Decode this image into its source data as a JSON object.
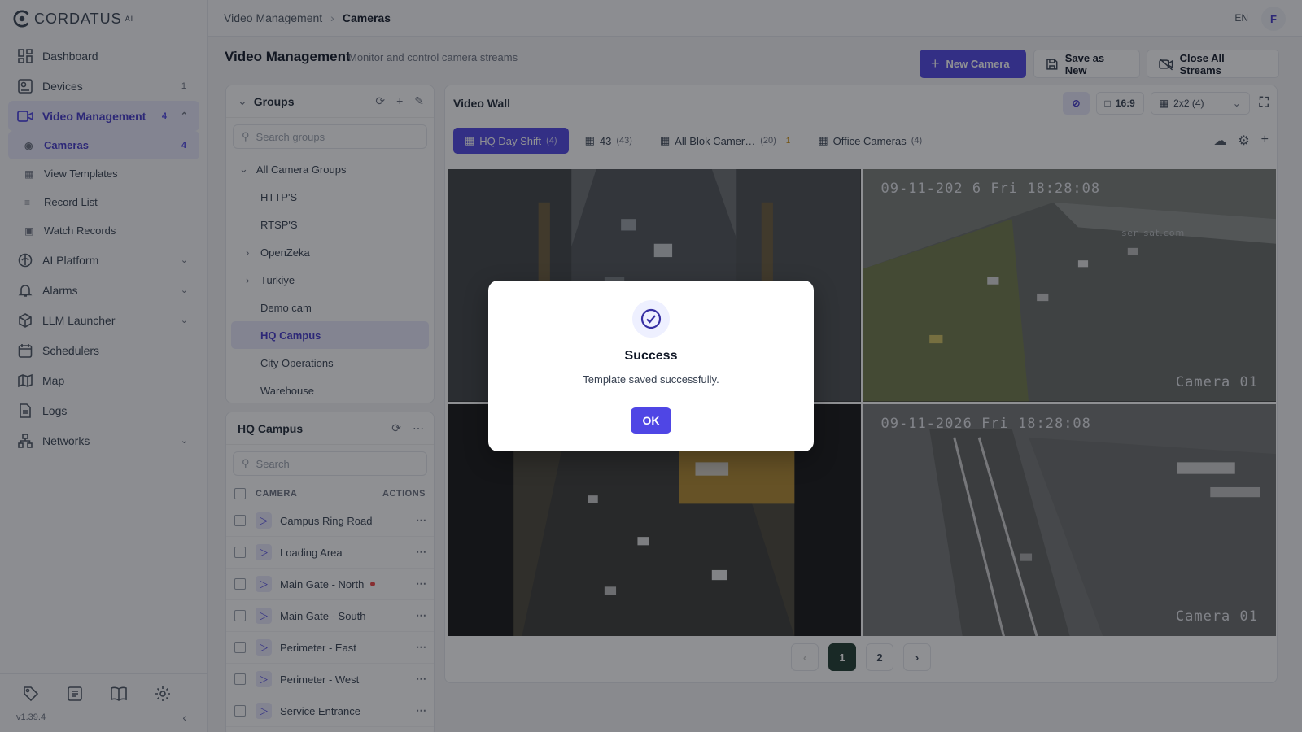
{
  "app": {
    "brand": "CORDATUS",
    "brand_sup": "AI",
    "version": "v1.39.4"
  },
  "sidebar": {
    "items": [
      {
        "label": "Dashboard",
        "icon": "dashboard-icon"
      },
      {
        "label": "Devices",
        "icon": "devices-icon",
        "badge": "1"
      },
      {
        "label": "Video Management",
        "icon": "video-icon",
        "badge": "4",
        "active": true
      },
      {
        "label": "AI Platform",
        "icon": "ai-icon"
      },
      {
        "label": "Alarms",
        "icon": "bell-icon"
      },
      {
        "label": "LLM Launcher",
        "icon": "llm-icon"
      },
      {
        "label": "Schedulers",
        "icon": "calendar-icon"
      },
      {
        "label": "Map",
        "icon": "map-icon"
      },
      {
        "label": "Logs",
        "icon": "logs-icon"
      },
      {
        "label": "Networks",
        "icon": "network-icon"
      }
    ],
    "subitems": [
      {
        "label": "Cameras",
        "badge": "4",
        "active": true
      },
      {
        "label": "View Templates"
      },
      {
        "label": "Record List"
      },
      {
        "label": "Watch Records"
      }
    ]
  },
  "topbar": {
    "crumb1": "Video Management",
    "crumb2": "Cameras",
    "lang": "EN",
    "avatar": "F"
  },
  "header": {
    "title": "Video Management",
    "subtitle": "Monitor and control camera streams",
    "new_camera": "New Camera",
    "save_as_new": "Save as New",
    "close_all": "Close All Streams"
  },
  "groups": {
    "title": "Groups",
    "search_placeholder": "Search groups",
    "root": "All Camera Groups",
    "items": [
      "HTTP'S",
      "RTSP'S",
      "OpenZeka",
      "Turkiye",
      "Demo cam",
      "HQ Campus",
      "City Operations",
      "Warehouse"
    ]
  },
  "camera_list": {
    "title": "HQ Campus",
    "search_placeholder": "Search",
    "col_camera": "CAMERA",
    "col_actions": "ACTIONS",
    "rows": [
      "Campus Ring Road",
      "Loading Area",
      "Main Gate - North",
      "Main Gate - South",
      "Perimeter - East",
      "Perimeter - West",
      "Service Entrance"
    ]
  },
  "wall": {
    "title": "Video Wall",
    "ratio": "16:9",
    "layout": "2x2 (4)",
    "tabs": [
      {
        "label": "HQ Day Shift",
        "count": "(4)"
      },
      {
        "label": "43",
        "count": "(43)"
      },
      {
        "label": "All Blok Camer…",
        "count": "(20)",
        "warn": "1"
      },
      {
        "label": "Office Cameras",
        "count": "(4)"
      }
    ],
    "osd": {
      "cam2_time": "09-11-202  6 Fri 18:28:08",
      "cam2_name": "Camera 01",
      "cam2_watermark": "sen sat.com",
      "cam4_time": "09-11-2026 Fri 18:28:08",
      "cam4_name": "Camera 01"
    },
    "pages": [
      "1",
      "2"
    ],
    "current_page": 1
  },
  "modal": {
    "title": "Success",
    "message": "Template saved successfully.",
    "ok": "OK"
  }
}
